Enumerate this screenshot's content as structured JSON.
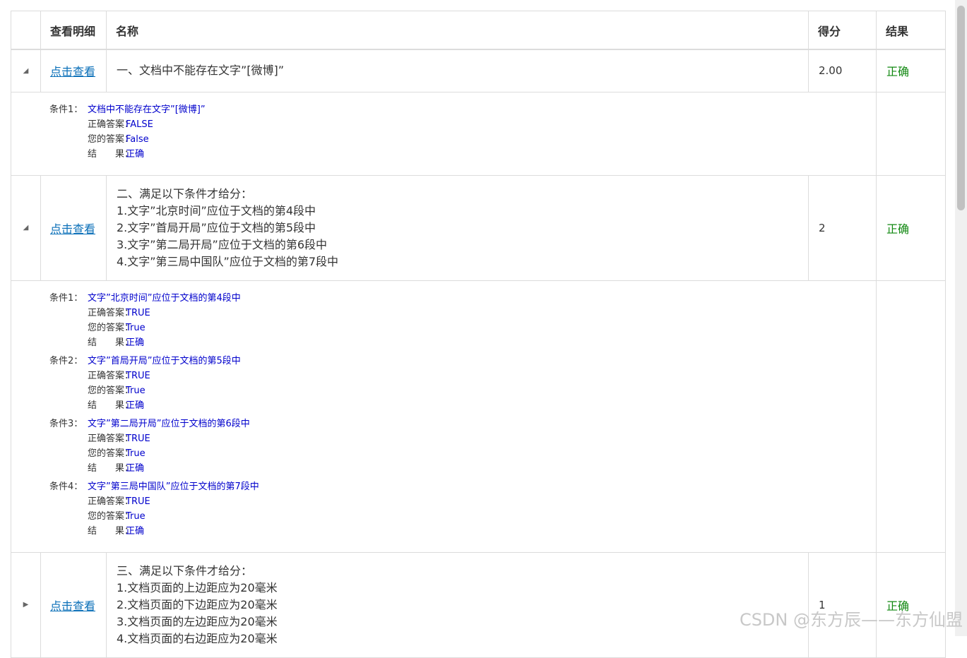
{
  "header": {
    "col_view": "查看明细",
    "col_name": "名称",
    "col_score": "得分",
    "col_result": "结果"
  },
  "rows": [
    {
      "toggle": "◢",
      "link": "点击查看",
      "name": "一、文档中不能存在文字”[微博]”",
      "score": "2.00",
      "result": "正确",
      "conditions": [
        {
          "label": "条件1：",
          "title": "文档中不能存在文字”[微博]”",
          "correct_label": "正确答案：",
          "correct": "FALSE",
          "yours_label": "您的答案：",
          "yours": "False",
          "result_label": "结　　果：",
          "result": "正确"
        }
      ]
    },
    {
      "toggle": "◢",
      "link": "点击查看",
      "name_lines": [
        "二、满足以下条件才给分：",
        "1.文字”北京时间”应位于文档的第4段中",
        "2.文字”首局开局”应位于文档的第5段中",
        "3.文字”第二局开局”应位于文档的第6段中",
        "4.文字”第三局中国队”应位于文档的第7段中"
      ],
      "score": "2",
      "result": "正确",
      "conditions": [
        {
          "label": "条件1：",
          "title": "文字”北京时间”应位于文档的第4段中",
          "correct_label": "正确答案：",
          "correct": "TRUE",
          "yours_label": "您的答案：",
          "yours": "True",
          "result_label": "结　　果：",
          "result": "正确"
        },
        {
          "label": "条件2：",
          "title": "文字”首局开局”应位于文档的第5段中",
          "correct_label": "正确答案：",
          "correct": "TRUE",
          "yours_label": "您的答案：",
          "yours": "True",
          "result_label": "结　　果：",
          "result": "正确"
        },
        {
          "label": "条件3：",
          "title": "文字”第二局开局”应位于文档的第6段中",
          "correct_label": "正确答案：",
          "correct": "TRUE",
          "yours_label": "您的答案：",
          "yours": "True",
          "result_label": "结　　果：",
          "result": "正确"
        },
        {
          "label": "条件4：",
          "title": "文字”第三局中国队”应位于文档的第7段中",
          "correct_label": "正确答案：",
          "correct": "TRUE",
          "yours_label": "您的答案：",
          "yours": "True",
          "result_label": "结　　果：",
          "result": "正确"
        }
      ]
    },
    {
      "toggle": "▶",
      "link": "点击查看",
      "name_lines": [
        "三、满足以下条件才给分：",
        "1.文档页面的上边距应为20毫米",
        "2.文档页面的下边距应为20毫米",
        "3.文档页面的左边距应为20毫米",
        "4.文档页面的右边距应为20毫米"
      ],
      "score": "1",
      "result": "正确"
    }
  ],
  "watermark": "CSDN @东方辰——东方仙盟"
}
